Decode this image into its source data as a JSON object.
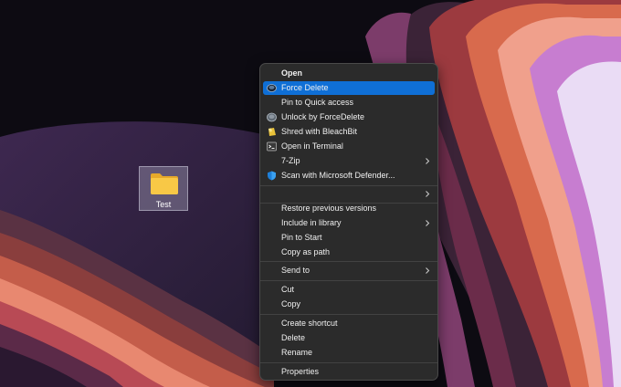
{
  "desktop": {
    "folder_label": "Test"
  },
  "context_menu": {
    "items": [
      {
        "label": "Open",
        "icon": "none",
        "bold": true
      },
      {
        "label": "Force Delete",
        "icon": "force-delete-icon",
        "highlighted": true
      },
      {
        "label": "Pin to Quick access",
        "icon": "none"
      },
      {
        "label": "Unlock by ForceDelete",
        "icon": "unlock-icon"
      },
      {
        "label": "Shred with BleachBit",
        "icon": "bleachbit-icon"
      },
      {
        "label": "Open in Terminal",
        "icon": "terminal-icon"
      },
      {
        "label": "7-Zip",
        "icon": "none",
        "submenu": true
      },
      {
        "label": "Scan with Microsoft Defender...",
        "icon": "defender-shield-icon"
      },
      {
        "label": "",
        "icon": "none",
        "submenu": true
      },
      {
        "label": "Restore previous versions",
        "icon": "none"
      },
      {
        "label": "Include in library",
        "icon": "none",
        "submenu": true
      },
      {
        "label": "Pin to Start",
        "icon": "none"
      },
      {
        "label": "Copy as path",
        "icon": "none"
      },
      {
        "label": "Send to",
        "icon": "none",
        "submenu": true
      },
      {
        "label": "Cut",
        "icon": "none"
      },
      {
        "label": "Copy",
        "icon": "none"
      },
      {
        "label": "Create shortcut",
        "icon": "none"
      },
      {
        "label": "Delete",
        "icon": "none"
      },
      {
        "label": "Rename",
        "icon": "none"
      },
      {
        "label": "Properties",
        "icon": "none"
      }
    ]
  },
  "colors": {
    "menu_background": "#2b2b2b",
    "highlight": "#0f6fd6",
    "folder_yellow": "#f8c846"
  }
}
